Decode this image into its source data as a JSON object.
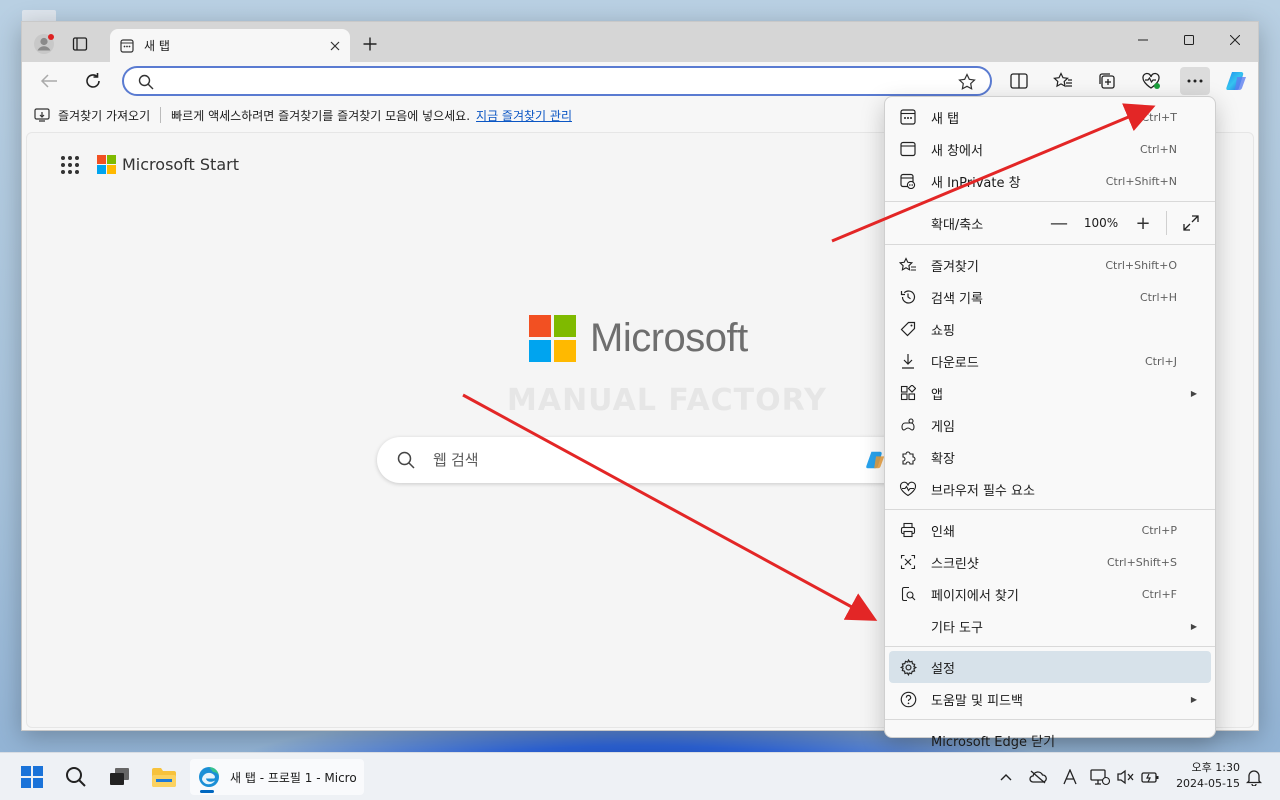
{
  "tab": {
    "title": "새 탭"
  },
  "address": {
    "value": "",
    "placeholder": ""
  },
  "favorites_bar": {
    "import_label": "즐겨찾기 가져오기",
    "hint": "빠르게 액세스하려면 즐겨찾기를 즐겨찾기 모음에 넣으세요.",
    "manage_link": "지금 즐겨찾기 관리"
  },
  "page": {
    "ms_start": "Microsoft Start",
    "brand": "Microsoft",
    "watermark": "MANUAL FACTORY",
    "search_placeholder": "웹 검색"
  },
  "menu": {
    "new_tab": {
      "label": "새 탭",
      "shortcut": "Ctrl+T"
    },
    "new_window": {
      "label": "새 창에서",
      "shortcut": "Ctrl+N"
    },
    "new_inprivate": {
      "label": "새 InPrivate 창",
      "shortcut": "Ctrl+Shift+N"
    },
    "zoom": {
      "label": "확대/축소",
      "minus": "—",
      "value": "100%",
      "plus": "+"
    },
    "favorites": {
      "label": "즐겨찾기",
      "shortcut": "Ctrl+Shift+O"
    },
    "history": {
      "label": "검색 기록",
      "shortcut": "Ctrl+H"
    },
    "shopping": {
      "label": "쇼핑"
    },
    "downloads": {
      "label": "다운로드",
      "shortcut": "Ctrl+J"
    },
    "apps": {
      "label": "앱"
    },
    "games": {
      "label": "게임"
    },
    "extensions": {
      "label": "확장"
    },
    "essentials": {
      "label": "브라우저 필수 요소"
    },
    "print": {
      "label": "인쇄",
      "shortcut": "Ctrl+P"
    },
    "screenshot": {
      "label": "스크린샷",
      "shortcut": "Ctrl+Shift+S"
    },
    "find": {
      "label": "페이지에서 찾기",
      "shortcut": "Ctrl+F"
    },
    "more_tools": {
      "label": "기타 도구"
    },
    "settings": {
      "label": "설정"
    },
    "help": {
      "label": "도움말 및 피드백"
    },
    "close": {
      "label": "Microsoft Edge 닫기"
    }
  },
  "taskbar": {
    "edge_window": "새 탭 - 프로필 1 - Micro",
    "time": "오후 1:30",
    "date": "2024-05-15"
  },
  "colors": {
    "accent": "#5a7bd1",
    "link": "#0b56c4",
    "annotation_arrow": "#e32626",
    "ms_red": "#f25022",
    "ms_green": "#7fba00",
    "ms_blue": "#00a4ef",
    "ms_yellow": "#ffb900"
  }
}
